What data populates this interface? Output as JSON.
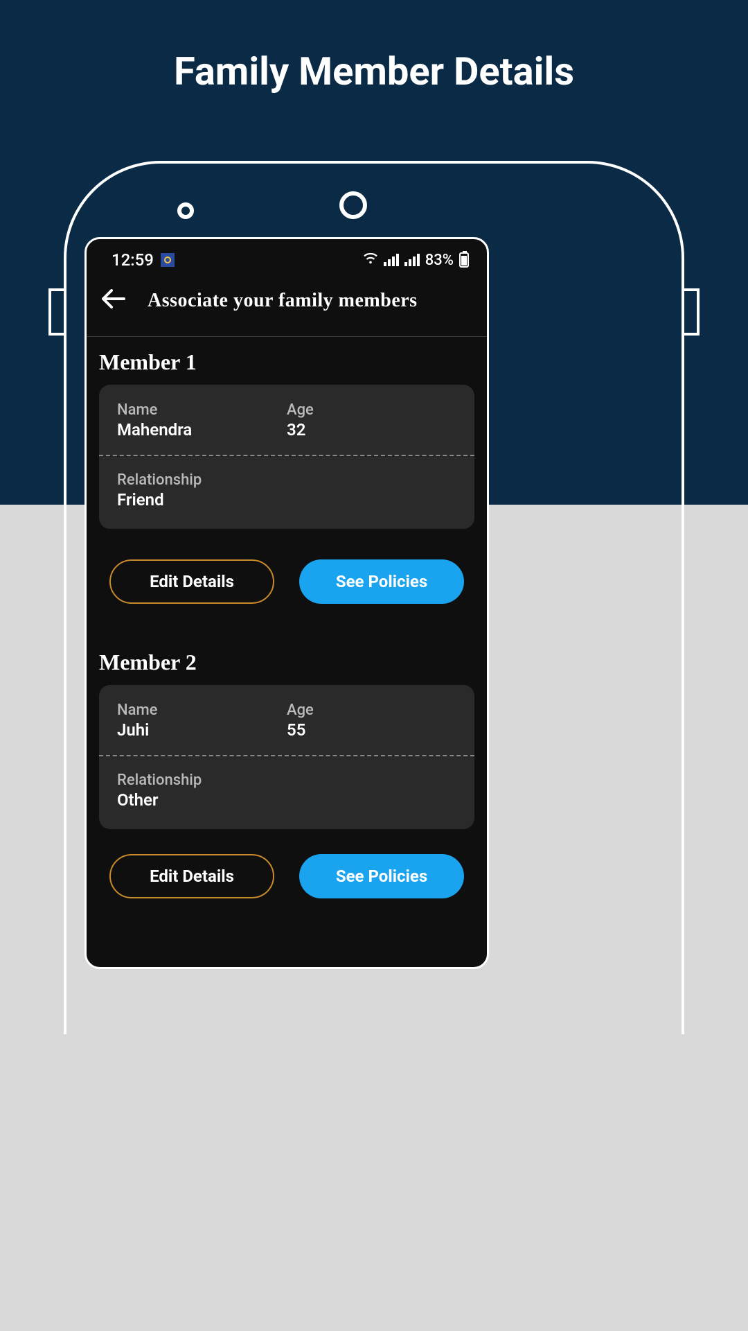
{
  "page": {
    "title": "Family Member Details"
  },
  "status_bar": {
    "time": "12:59",
    "battery_percent": "83%"
  },
  "app": {
    "title": "Associate your family members"
  },
  "labels": {
    "name": "Name",
    "age": "Age",
    "relationship": "Relationship",
    "edit_details": "Edit Details",
    "see_policies": "See Policies"
  },
  "members": [
    {
      "heading": "Member 1",
      "name": "Mahendra",
      "age": "32",
      "relationship": "Friend"
    },
    {
      "heading": "Member 2",
      "name": "Juhi",
      "age": "55",
      "relationship": "Other"
    }
  ],
  "colors": {
    "background_top": "#0a2a45",
    "background_bottom": "#d9d9d9",
    "screen_bg": "#0f0f0f",
    "card_bg": "#2a2a2a",
    "primary_button": "#1aa3ee",
    "outline_button_border": "#c88a2a"
  }
}
